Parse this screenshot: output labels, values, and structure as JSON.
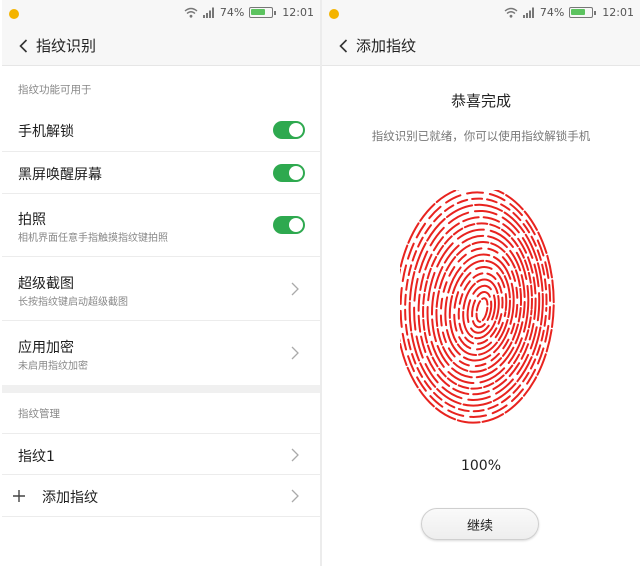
{
  "status": {
    "battery_percent": "74%",
    "time": "12:01",
    "battery_level": 0.74
  },
  "left": {
    "header": {
      "title": "指纹识别"
    },
    "section1_label": "指纹功能可用于",
    "toggles": [
      {
        "title": "手机解锁",
        "subtitle": "",
        "on": true
      },
      {
        "title": "黑屏唤醒屏幕",
        "subtitle": "",
        "on": true
      },
      {
        "title": "拍照",
        "subtitle": "相机界面任意手指触摸指纹键拍照",
        "on": true
      }
    ],
    "links": [
      {
        "title": "超级截图",
        "subtitle": "长按指纹键启动超级截图"
      },
      {
        "title": "应用加密",
        "subtitle": "未启用指纹加密"
      }
    ],
    "section2_label": "指纹管理",
    "fingerprints": [
      {
        "title": "指纹1"
      }
    ],
    "add_label": "添加指纹"
  },
  "right": {
    "header": {
      "title": "添加指纹"
    },
    "title": "恭喜完成",
    "description": "指纹识别已就绪，你可以使用指纹解锁手机",
    "progress": "100%",
    "continue_label": "继续"
  },
  "colors": {
    "accent": "#2ea94f",
    "fingerprint": "#e8231f",
    "statusbar_bg": "#f7f7f7"
  },
  "icons": [
    "wifi-icon",
    "signal-icon",
    "battery-icon",
    "back-arrow-icon",
    "chevron-right-icon",
    "plus-icon",
    "fingerprint-icon",
    "notification-icon"
  ]
}
